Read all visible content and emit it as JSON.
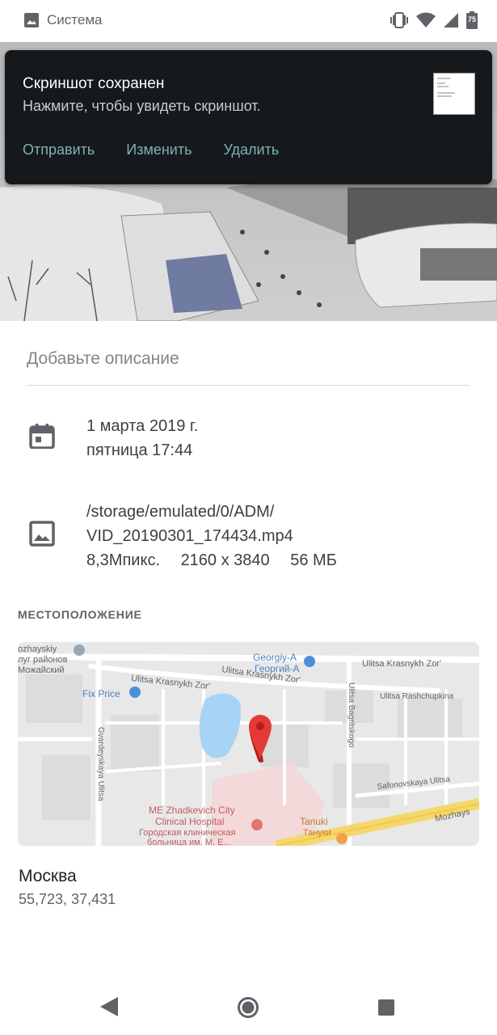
{
  "status_bar": {
    "app_name": "Система",
    "battery_level": "75"
  },
  "notification": {
    "title": "Скриншот сохранен",
    "text": "Нажмите, чтобы увидеть скриншот.",
    "actions": [
      "Отправить",
      "Изменить",
      "Удалить"
    ]
  },
  "details": {
    "description_placeholder": "Добавьте описание",
    "date": "1 марта 2019 г.",
    "weekday_time": "пятница 17:44",
    "path_line1": "/storage/emulated/0/ADM/",
    "path_line2": "VID_20190301_174434.mp4",
    "megapixels": "8,3Мпикс.",
    "resolution": "2160 x 3840",
    "size": "56 МБ"
  },
  "location": {
    "section_label": "МЕСТОПОЛОЖЕНИЕ",
    "city": "Москва",
    "coords": "55,723, 37,431",
    "map_labels": {
      "mozhayskiy_1": "ozhayskiy",
      "mozhayskiy_2": "луг районов",
      "mozhayskiy_3": "Можайский",
      "georgiy_en": "Georgiy-A",
      "georgiy_ru": "Георгий-А",
      "krasnykh_top": "Ulitsa Krasnykh Zor'",
      "krasnykh_mid": "Ulitsa Krasnykh Zor'",
      "krasnykh_left": "Ulitsa Krasnykh Zor'",
      "fix_price": "Fix Price",
      "bagritskogo": "Ulitsa Bagritskogo",
      "rashchupkina": "Ulitsa Rashchupkina",
      "gvardeyskaya": "Gvardeyskaya Ulitsa",
      "safonovskaya": "Safonovskaya Ulitsa",
      "hospital_1": "ME Zhadkevich City",
      "hospital_2": "Clinical Hospital",
      "hospital_3": "Городская клиническая",
      "hospital_4": "больница им. М. Е...",
      "tanuki_en": "Tanuki",
      "tanuki_ru": "Тануки",
      "mozhays": "Mozhays"
    }
  }
}
